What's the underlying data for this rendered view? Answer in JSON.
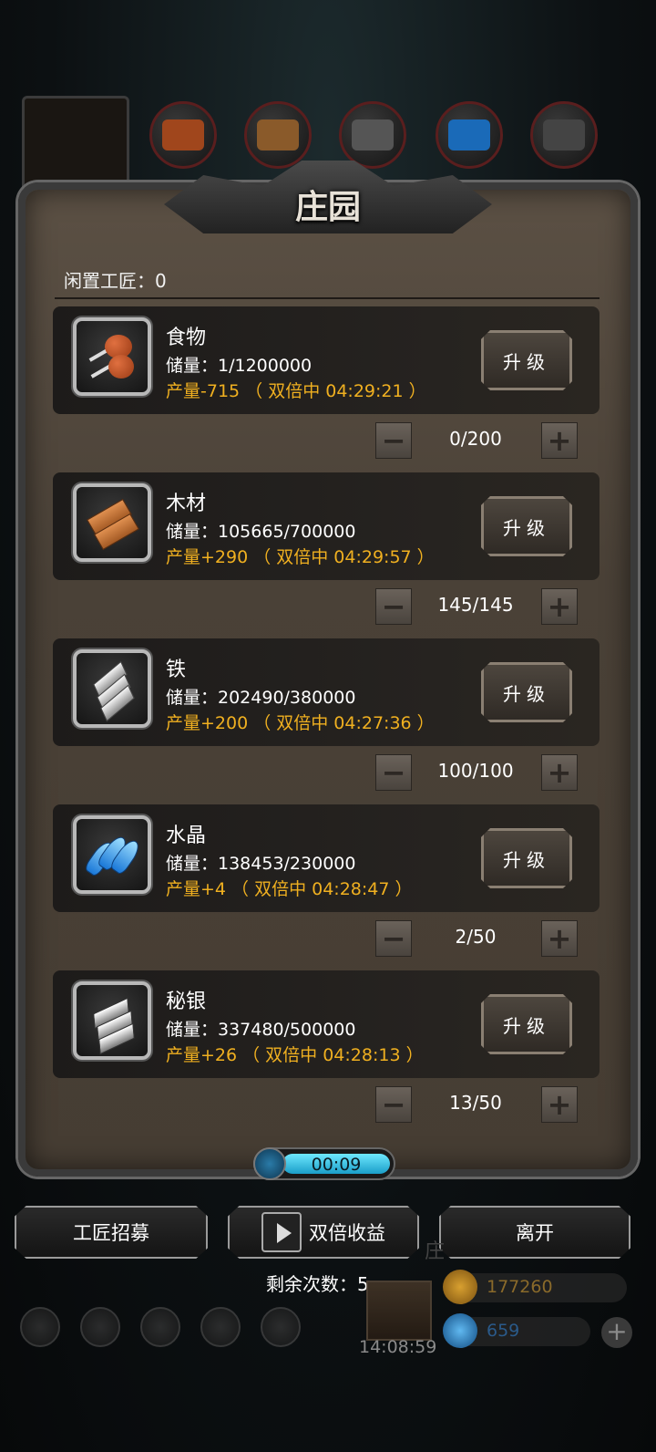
{
  "panel": {
    "title": "庄园",
    "idle_label": "闲置工匠：0"
  },
  "resources": [
    {
      "name": "食物",
      "storage": "储量：1/1200000",
      "production": "产量-715 （ 双倍中 04:29:21 ）",
      "upgrade_label": "升级",
      "workers": "0/200",
      "icon": "food-icon"
    },
    {
      "name": "木材",
      "storage": "储量：105665/700000",
      "production": "产量+290 （ 双倍中 04:29:57 ）",
      "upgrade_label": "升级",
      "workers": "145/145",
      "icon": "wood-icon"
    },
    {
      "name": "铁",
      "storage": "储量：202490/380000",
      "production": "产量+200 （ 双倍中 04:27:36 ）",
      "upgrade_label": "升级",
      "workers": "100/100",
      "icon": "iron-icon"
    },
    {
      "name": "水晶",
      "storage": "储量：138453/230000",
      "production": "产量+4 （ 双倍中 04:28:47 ）",
      "upgrade_label": "升级",
      "workers": "2/50",
      "icon": "crystal-icon"
    },
    {
      "name": "秘银",
      "storage": "储量：337480/500000",
      "production": "产量+26 （ 双倍中 04:28:13 ）",
      "upgrade_label": "升级",
      "workers": "13/50",
      "icon": "mithril-icon"
    }
  ],
  "stepper": {
    "minus": "−",
    "plus": "+"
  },
  "timer": {
    "text": "00:09",
    "fill_fraction": 1.0
  },
  "buttons": {
    "recruit": "工匠招募",
    "double": "双倍收益",
    "leave": "离开"
  },
  "remaining": "剩余次数：5",
  "background": {
    "gift_time": "14:08:59",
    "gold": "177260",
    "gems": "659",
    "char": "庄"
  },
  "colors": {
    "production": "#f0b020",
    "panel": "#4a4137",
    "timer_fill": "#3cc8ec"
  }
}
